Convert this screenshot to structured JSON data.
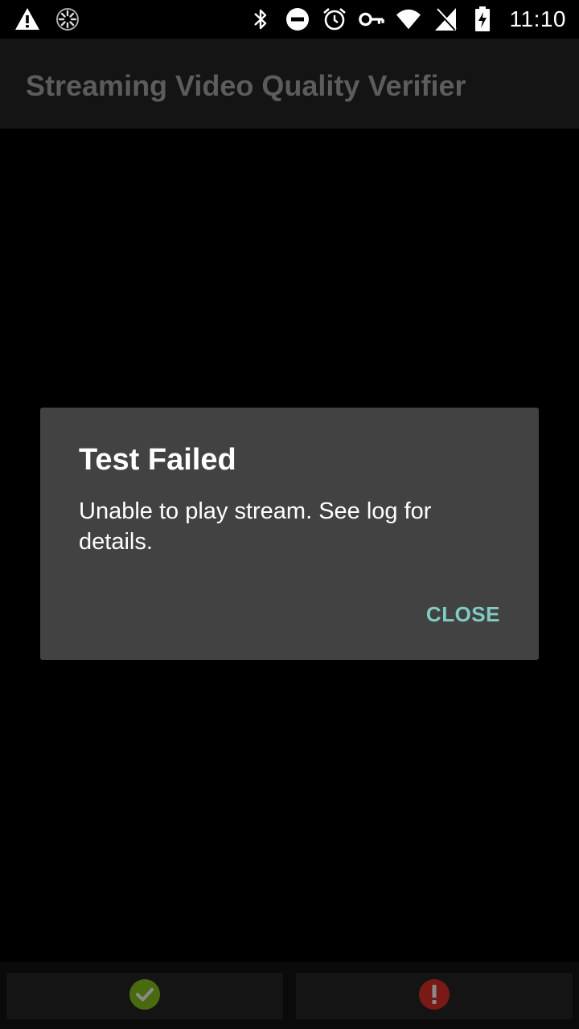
{
  "status_bar": {
    "time": "11:10",
    "left_icons": [
      "warning-icon",
      "sync-icon"
    ],
    "right_icons": [
      "bluetooth-icon",
      "do-not-disturb-icon",
      "alarm-icon",
      "vpn-key-icon",
      "wifi-icon",
      "no-sim-icon",
      "battery-charging-icon"
    ]
  },
  "app_bar": {
    "title": "Streaming Video Quality Verifier"
  },
  "dialog": {
    "title": "Test Failed",
    "message": "Unable to play stream. See log for details.",
    "close_label": "CLOSE"
  },
  "bottom_buttons": {
    "pass_icon": "check-circle-icon",
    "fail_icon": "error-circle-icon"
  },
  "colors": {
    "dialog_background": "#424242",
    "accent": "#80cbc4",
    "pass_green": "#4a6a10",
    "fail_red": "#7a1a16"
  }
}
